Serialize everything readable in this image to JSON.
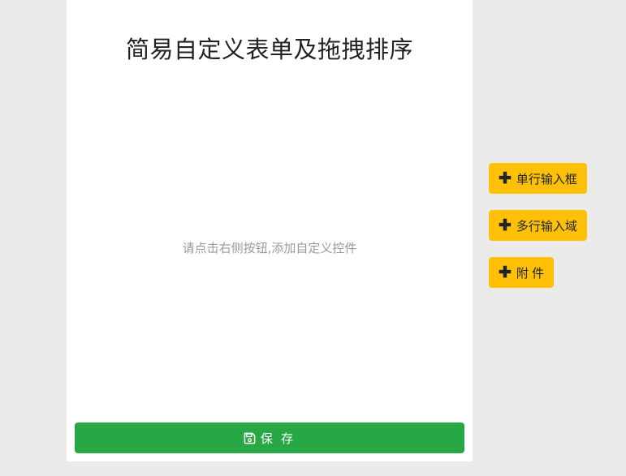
{
  "form": {
    "title": "简易自定义表单及拖拽排序",
    "empty_hint": "请点击右侧按钮,添加自定义控件",
    "save_label": "保 存",
    "save_icon": "floppy-disk-icon"
  },
  "toolbar": {
    "buttons": [
      {
        "label": "单行输入框",
        "icon": "plus-icon"
      },
      {
        "label": "多行输入域",
        "icon": "plus-icon"
      },
      {
        "label": "附 件",
        "icon": "plus-icon"
      }
    ]
  },
  "colors": {
    "background": "#ebebeb",
    "panel": "#ffffff",
    "save_button": "#28a745",
    "add_button": "#ffc107"
  }
}
